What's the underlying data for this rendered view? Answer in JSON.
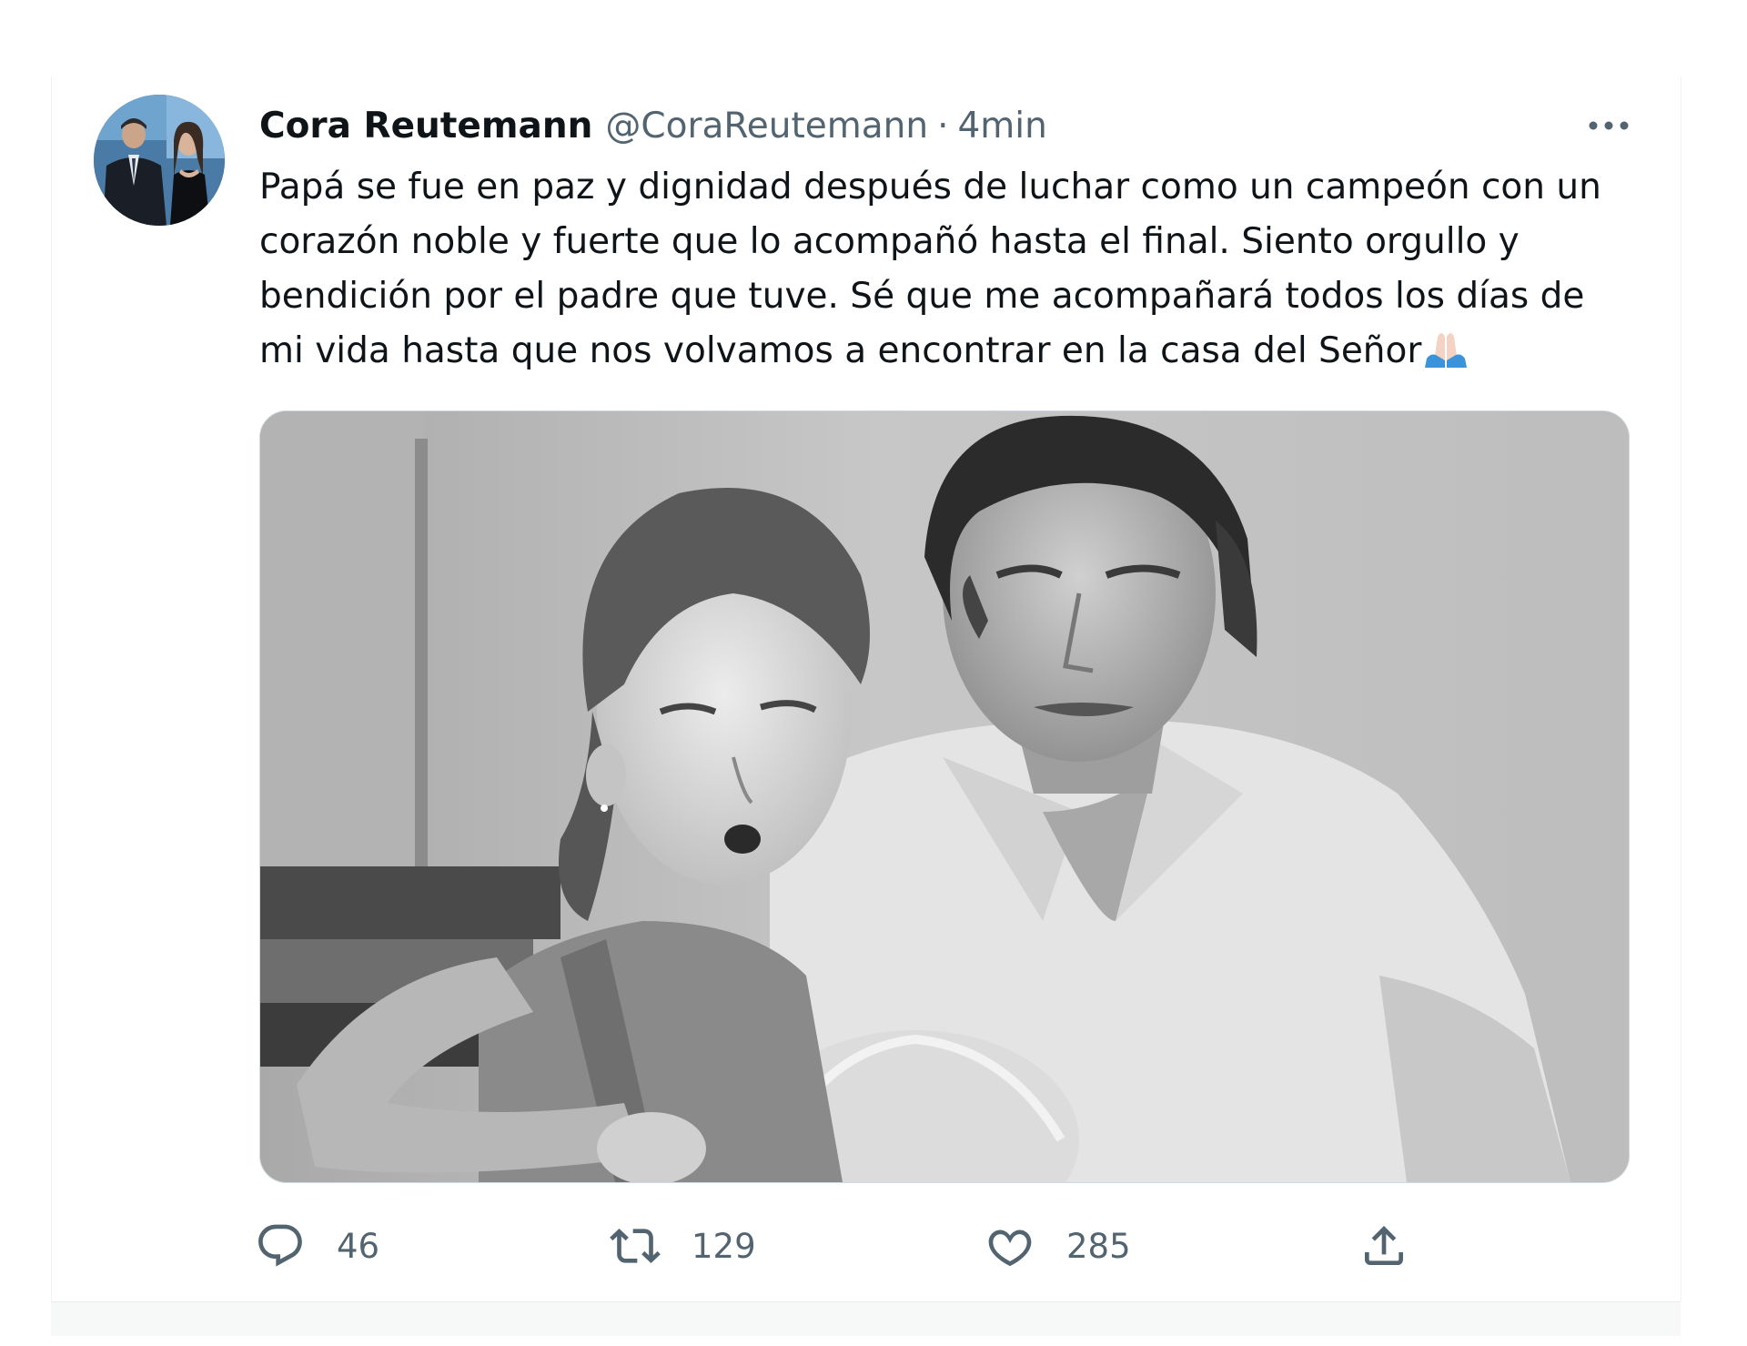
{
  "tweet": {
    "display_name": "Cora Reutemann",
    "handle": "@CoraReutemann",
    "separator": "·",
    "time": "4min",
    "text_lines": [
      "Papá se fue en paz y dignidad después de luchar como un campeón con un",
      "corazón noble y fuerte que lo acompañó hasta el final. Siento orgullo y",
      "bendición por el padre que tuve. Sé que me acompañará todos los días de",
      "mi vida hasta que nos volvamos a encontrar en la casa del Señor"
    ],
    "trailing_emoji": "folded-hands-emoji",
    "media_description_icon": "photo-black-and-white"
  },
  "actions": {
    "reply": {
      "icon": "reply-icon",
      "count": "46"
    },
    "retweet": {
      "icon": "retweet-icon",
      "count": "129"
    },
    "like": {
      "icon": "heart-icon",
      "count": "285"
    },
    "share": {
      "icon": "share-icon"
    }
  },
  "more": {
    "icon": "more-icon"
  },
  "colors": {
    "text_primary": "#0f1419",
    "text_secondary": "#536471",
    "border": "#cfd9de"
  }
}
